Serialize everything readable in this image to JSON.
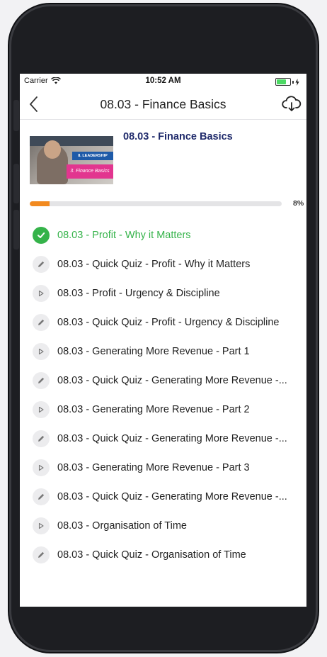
{
  "status_bar": {
    "carrier": "Carrier",
    "time": "10:52 AM"
  },
  "nav": {
    "title": "08.03 - Finance Basics",
    "back_icon": "chevron-left-icon",
    "download_icon": "cloud-download-icon"
  },
  "course": {
    "title": "08.03 - Finance Basics",
    "thumbnail_tag_1": "8. LEADERSHIP",
    "thumbnail_tag_2": "3. Finance Basics",
    "progress_percent": 8,
    "progress_label": "8%"
  },
  "colors": {
    "accent_progress": "#f28a1f",
    "completed": "#35b34a",
    "title_blue": "#1f2a6b"
  },
  "lessons": [
    {
      "label": "08.03 - Profit - Why it Matters",
      "type": "done",
      "icon": "check-icon"
    },
    {
      "label": "08.03 - Quick Quiz - Profit - Why it Matters",
      "type": "quiz",
      "icon": "pencil-icon"
    },
    {
      "label": "08.03 - Profit - Urgency & Discipline",
      "type": "video",
      "icon": "play-icon"
    },
    {
      "label": "08.03 - Quick Quiz - Profit - Urgency & Discipline",
      "type": "quiz",
      "icon": "pencil-icon"
    },
    {
      "label": "08.03 - Generating More Revenue - Part 1",
      "type": "video",
      "icon": "play-icon"
    },
    {
      "label": "08.03 - Quick Quiz - Generating More Revenue -...",
      "type": "quiz",
      "icon": "pencil-icon"
    },
    {
      "label": "08.03 - Generating More Revenue - Part 2",
      "type": "video",
      "icon": "play-icon"
    },
    {
      "label": "08.03 - Quick Quiz - Generating More Revenue -...",
      "type": "quiz",
      "icon": "pencil-icon"
    },
    {
      "label": "08.03 - Generating More Revenue - Part 3",
      "type": "video",
      "icon": "play-icon"
    },
    {
      "label": "08.03 - Quick Quiz - Generating More Revenue -...",
      "type": "quiz",
      "icon": "pencil-icon"
    },
    {
      "label": "08.03 - Organisation of Time",
      "type": "video",
      "icon": "play-icon"
    },
    {
      "label": "08.03 - Quick Quiz - Organisation of Time",
      "type": "quiz",
      "icon": "pencil-icon"
    }
  ]
}
